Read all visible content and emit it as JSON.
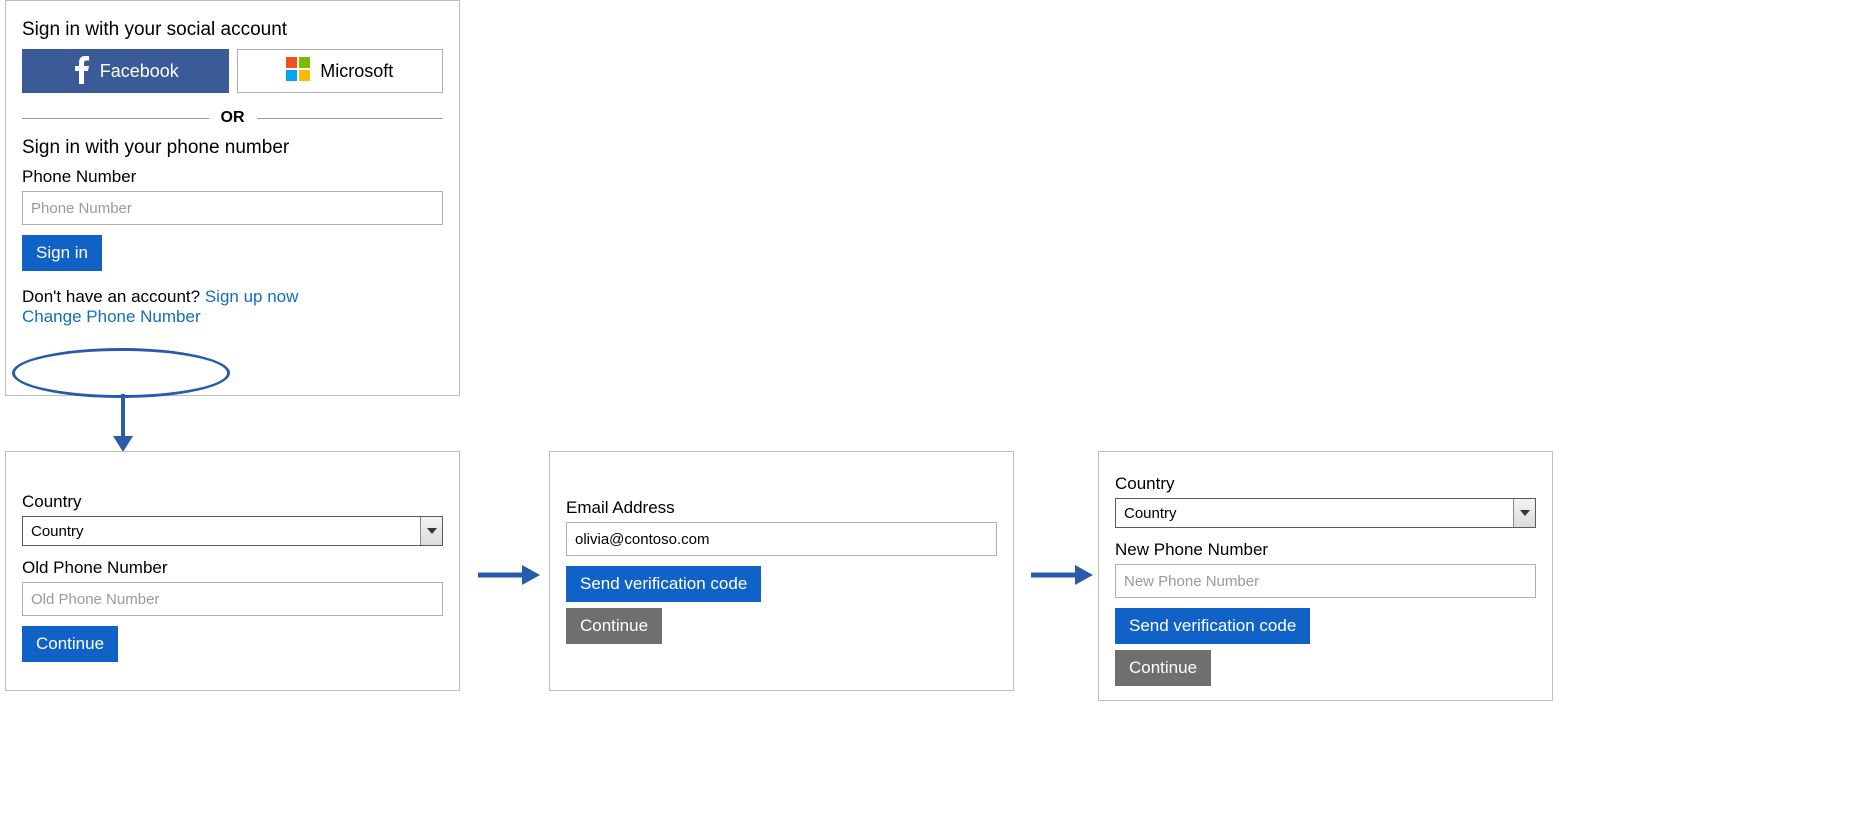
{
  "signin": {
    "social_heading": "Sign in with your social account",
    "facebook_label": "Facebook",
    "microsoft_label": "Microsoft",
    "or_label": "OR",
    "phone_heading": "Sign in with your phone number",
    "phone_label": "Phone Number",
    "phone_placeholder": "Phone Number",
    "signin_button": "Sign in",
    "no_account_prompt": "Don't have an account?",
    "signup_link": "Sign up now",
    "change_phone_link": "Change Phone Number"
  },
  "step1": {
    "country_label": "Country",
    "country_value": "Country",
    "old_phone_label": "Old Phone Number",
    "old_phone_placeholder": "Old Phone Number",
    "continue_button": "Continue"
  },
  "step2": {
    "email_label": "Email Address",
    "email_value": "olivia@contoso.com",
    "send_code_button": "Send verification code",
    "continue_button": "Continue"
  },
  "step3": {
    "country_label": "Country",
    "country_value": "Country",
    "new_phone_label": "New Phone Number",
    "new_phone_placeholder": "New Phone Number",
    "send_code_button": "Send verification code",
    "continue_button": "Continue"
  }
}
